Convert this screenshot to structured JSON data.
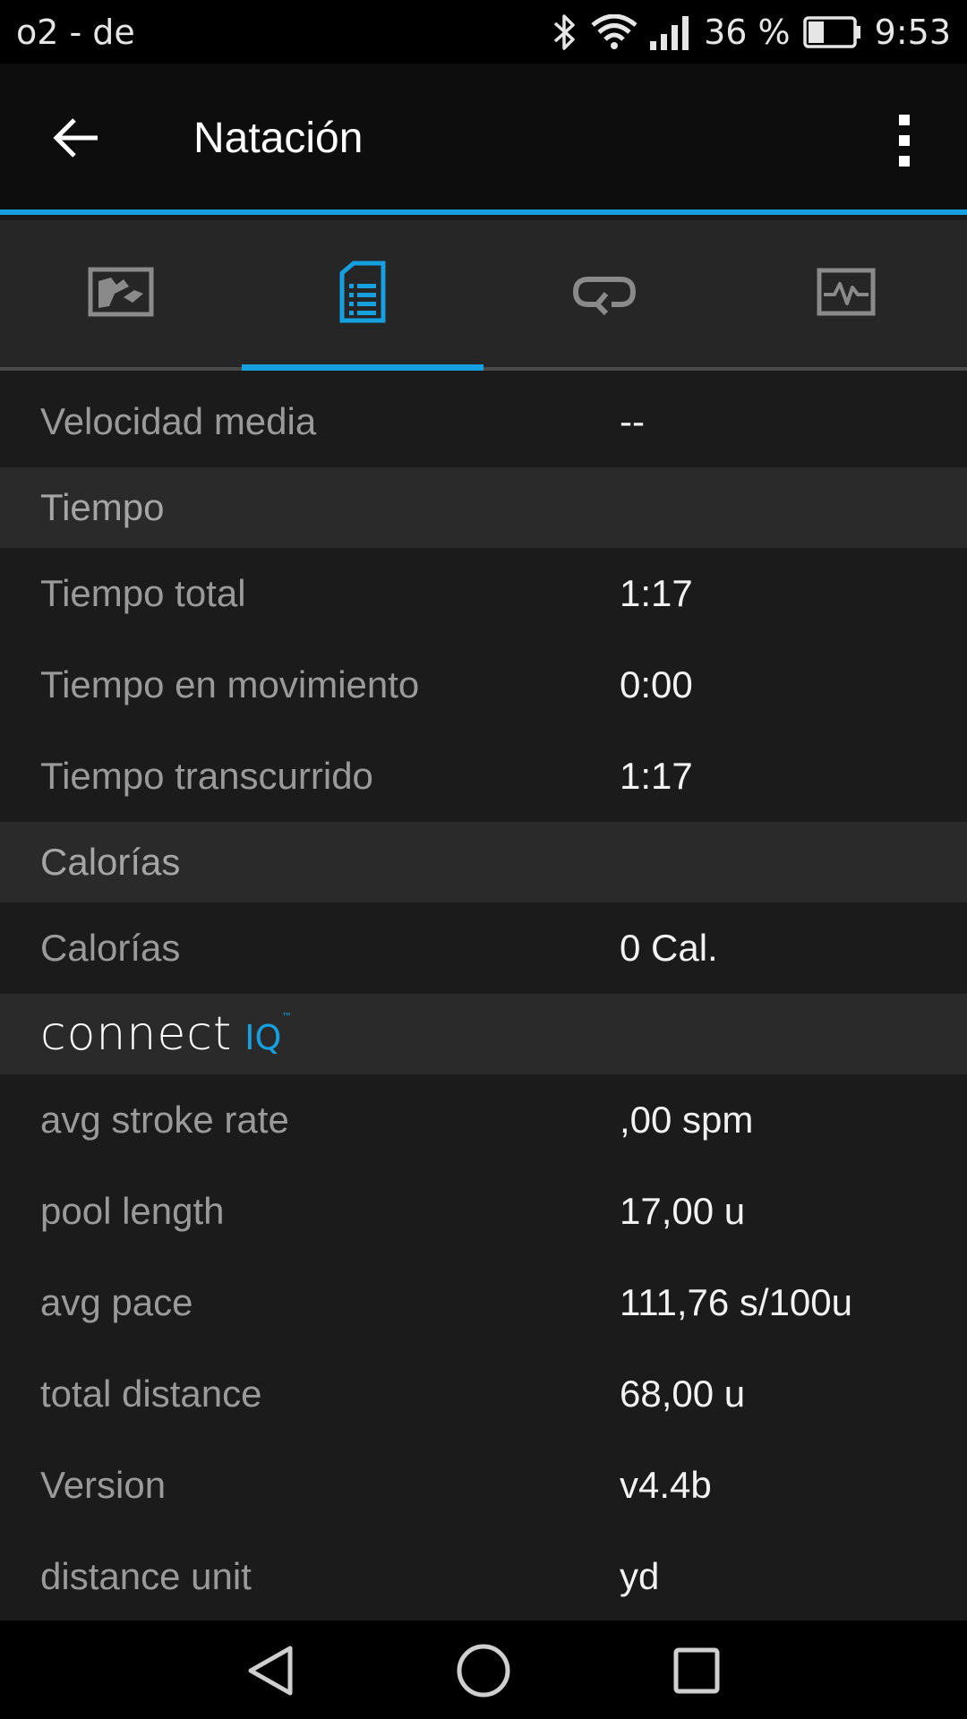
{
  "status_bar": {
    "carrier": "o2 - de",
    "battery_percent": "36 %",
    "battery_level": 0.36,
    "time": "9:53",
    "icons": [
      "bluetooth-icon",
      "wifi-icon",
      "signal-icon",
      "battery-icon"
    ]
  },
  "app_bar": {
    "title": "Natación",
    "back_icon": "arrow-left-icon",
    "menu_icon": "more-vert-icon"
  },
  "tabs": [
    {
      "name": "map",
      "icon": "map-icon",
      "active": false
    },
    {
      "name": "details",
      "icon": "document-list-icon",
      "active": true
    },
    {
      "name": "laps",
      "icon": "laps-loop-icon",
      "active": false
    },
    {
      "name": "charts",
      "icon": "chart-icon",
      "active": false
    }
  ],
  "rows": {
    "avg_speed": {
      "label": "Velocidad media",
      "value": "--"
    },
    "time_header": {
      "label": "Tiempo"
    },
    "total_time": {
      "label": "Tiempo total",
      "value": "1:17"
    },
    "moving_time": {
      "label": "Tiempo en movimiento",
      "value": "0:00"
    },
    "elapsed_time": {
      "label": "Tiempo transcurrido",
      "value": "1:17"
    },
    "calories_header": {
      "label": "Calorías"
    },
    "calories": {
      "label": "Calorías",
      "value": "0 Cal."
    },
    "connect_iq_header": {
      "logo_main": "connect",
      "logo_suffix": "IQ",
      "logo_tm": "™"
    },
    "avg_stroke_rate": {
      "label": "avg stroke rate",
      "value": ",00 spm"
    },
    "pool_length": {
      "label": "pool length",
      "value": "17,00 u"
    },
    "avg_pace": {
      "label": "avg pace",
      "value": "111,76 s/100u"
    },
    "total_distance": {
      "label": "total distance",
      "value": "68,00 u"
    },
    "version": {
      "label": "Version",
      "value": "v4.4b"
    },
    "distance_unit": {
      "label": "distance unit",
      "value": "yd"
    }
  },
  "colors": {
    "accent": "#16a0e0",
    "background": "#1b1b1b",
    "section_header": "#2a2a2a",
    "label_text": "#9a9a9a",
    "value_text": "#f2f2f2"
  },
  "nav_bar": {
    "icons": [
      "back-triangle-icon",
      "home-circle-icon",
      "recents-square-icon"
    ]
  }
}
